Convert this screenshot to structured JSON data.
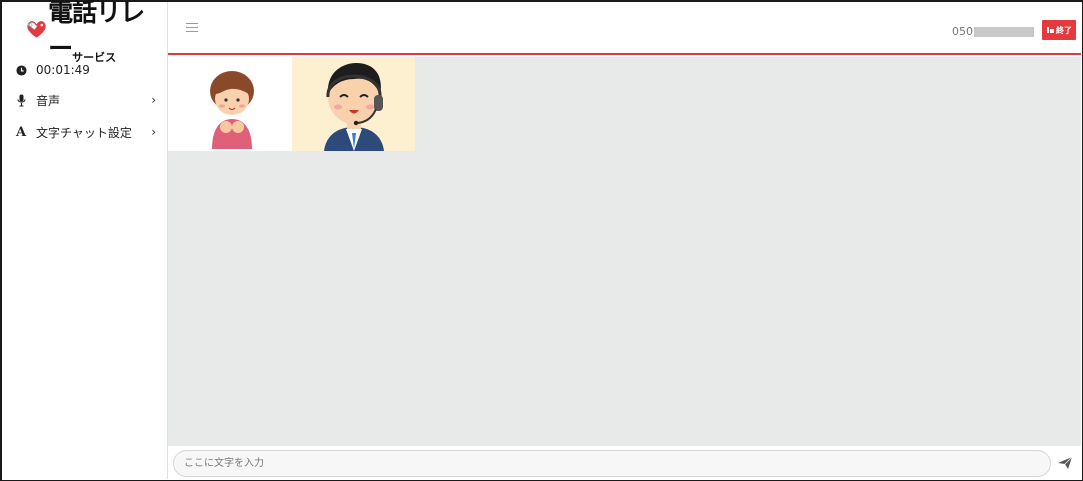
{
  "app": {
    "logo_text": "電話リレー",
    "logo_subtext": "サービス"
  },
  "sidebar": {
    "timer": "00:01:49",
    "items": [
      {
        "label": "音声",
        "icon": "microphone-icon"
      },
      {
        "label": "文字チャット設定",
        "icon": "text-a-icon"
      }
    ]
  },
  "header": {
    "phone_prefix": "050",
    "end_button_label": "終了",
    "accent_color": "#e23a3f"
  },
  "chat": {
    "placeholder": "ここに文字を入力"
  }
}
